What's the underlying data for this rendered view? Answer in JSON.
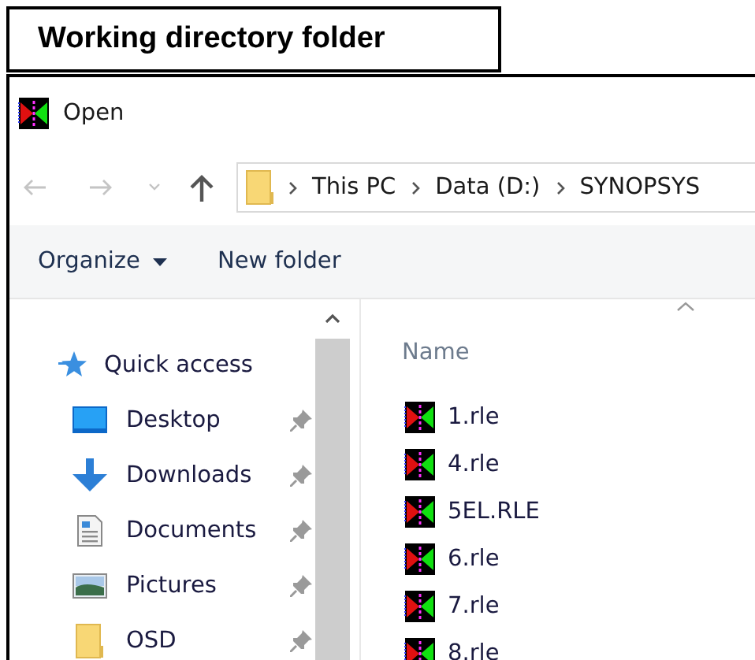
{
  "caption": "Working directory folder",
  "window": {
    "title": "Open"
  },
  "address": {
    "segments": [
      "This PC",
      "Data (D:)",
      "SYNOPSYS"
    ]
  },
  "toolbar": {
    "organize": "Organize",
    "new_folder": "New folder"
  },
  "nav_pane": {
    "items": [
      {
        "label": "Quick access",
        "kind": "quick"
      },
      {
        "label": "Desktop",
        "kind": "desktop",
        "pinned": true
      },
      {
        "label": "Downloads",
        "kind": "downloads",
        "pinned": true
      },
      {
        "label": "Documents",
        "kind": "documents",
        "pinned": true
      },
      {
        "label": "Pictures",
        "kind": "pictures",
        "pinned": true
      },
      {
        "label": "OSD",
        "kind": "folder",
        "pinned": true
      }
    ]
  },
  "file_list": {
    "columns": [
      "Name"
    ],
    "files": [
      "1.rle",
      "4.rle",
      "5EL.RLE",
      "6.rle",
      "7.rle",
      "8.rle"
    ]
  }
}
